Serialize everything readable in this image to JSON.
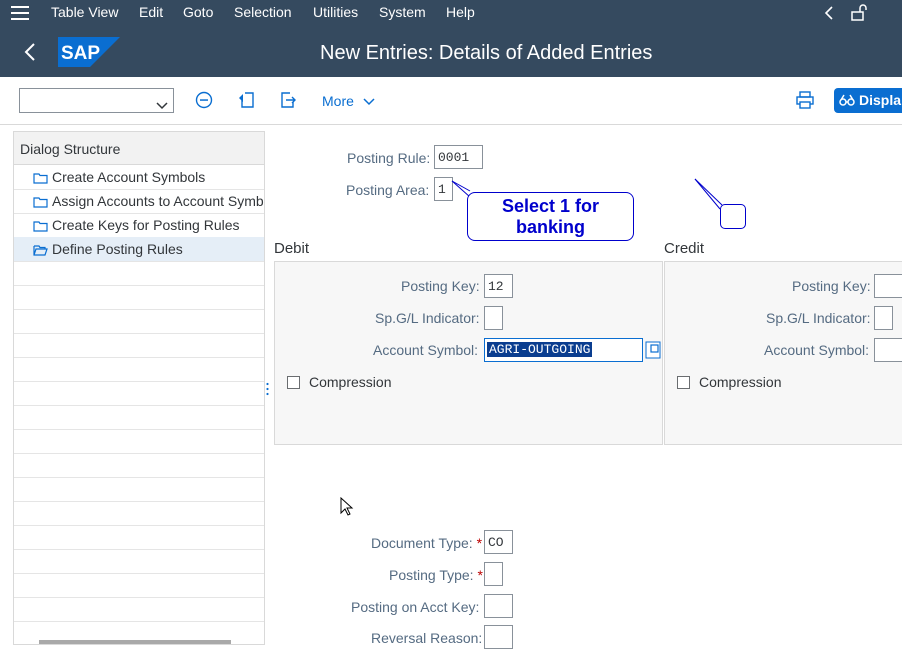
{
  "menubar": {
    "items": [
      "Table View",
      "Edit",
      "Goto",
      "Selection",
      "Utilities",
      "System",
      "Help"
    ]
  },
  "header": {
    "title": "New Entries: Details of Added Entries",
    "logo_text": "SAP"
  },
  "toolbar": {
    "command_value": "",
    "more_label": "More",
    "display_label": "Displa"
  },
  "dialog_structure": {
    "title": "Dialog Structure",
    "items": [
      {
        "label": "Create Account Symbols"
      },
      {
        "label": "Assign Accounts to Account Symbo"
      },
      {
        "label": "Create Keys for Posting Rules"
      },
      {
        "label": "Define Posting Rules"
      }
    ]
  },
  "form": {
    "posting_rule_label": "Posting Rule:",
    "posting_rule_value": "0001",
    "posting_area_label": "Posting Area:",
    "posting_area_value": "1",
    "callout": "Select 1 for banking",
    "debit": {
      "title": "Debit",
      "posting_key_label": "Posting Key:",
      "posting_key_value": "12",
      "spgl_label": "Sp.G/L Indicator:",
      "spgl_value": "",
      "account_symbol_label": "Account Symbol:",
      "account_symbol_value": "AGRI-OUTGOING",
      "compression_label": "Compression"
    },
    "credit": {
      "title": "Credit",
      "posting_key_label": "Posting Key:",
      "spgl_label": "Sp.G/L Indicator:",
      "account_symbol_label": "Account Symbol:",
      "compression_label": "Compression"
    },
    "document_type_label": "Document Type:",
    "document_type_value": "CO",
    "posting_type_label": "Posting Type:",
    "posting_type_value": "",
    "posting_on_acct_key_label": "Posting on Acct Key:",
    "reversal_reason_label": "Reversal Reason:",
    "required_marker": "*"
  },
  "colors": {
    "shell": "#354a5f",
    "accent": "#0a6ed1",
    "callout_border": "#0000cc",
    "selection": "#0a3d8f"
  }
}
